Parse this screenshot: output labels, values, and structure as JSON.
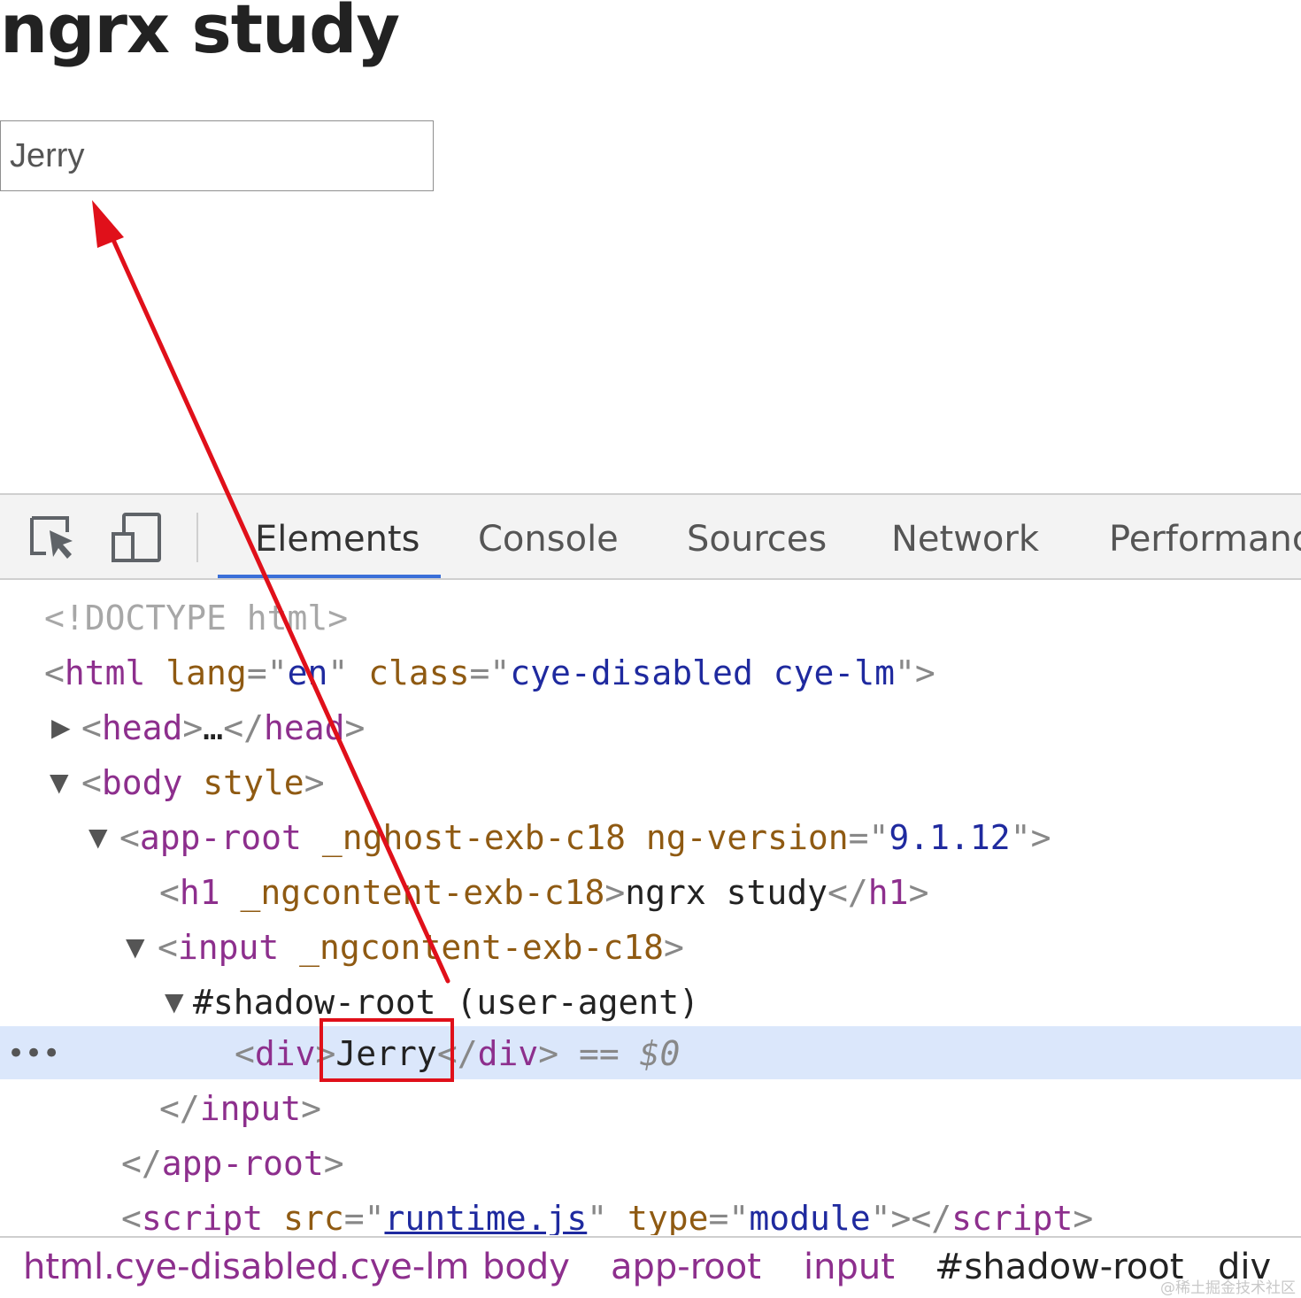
{
  "page": {
    "heading": "ngrx study",
    "input_value": "Jerry"
  },
  "devtools": {
    "icons": [
      "inspect-element-icon",
      "device-toolbar-icon"
    ],
    "tabs": [
      {
        "label": "Elements",
        "active": true
      },
      {
        "label": "Console",
        "active": false
      },
      {
        "label": "Sources",
        "active": false
      },
      {
        "label": "Network",
        "active": false
      },
      {
        "label": "Performanc",
        "active": false
      }
    ],
    "tree": {
      "doctype": "<!DOCTYPE html>",
      "html_open": {
        "tag": "html",
        "attr1": "lang",
        "val1": "en",
        "attr2": "class",
        "val2": "cye-disabled cye-lm"
      },
      "head": {
        "tag": "head",
        "ellipsis": "…"
      },
      "body": {
        "tag": "body",
        "attr": "style"
      },
      "app_root": {
        "tag": "app-root",
        "attr1": "_nghost-exb-c18",
        "attr2": "ng-version",
        "val2": "9.1.12"
      },
      "h1": {
        "tag": "h1",
        "attr": "_ngcontent-exb-c18",
        "text": "ngrx study"
      },
      "input": {
        "tag": "input",
        "attr": "_ngcontent-exb-c18"
      },
      "shadow_root": {
        "label": "#shadow-root",
        "mode": "(user-agent)"
      },
      "div": {
        "tag": "div",
        "text": "Jerry",
        "marker": "== $0"
      },
      "input_close": "input",
      "app_root_close": "app-root",
      "script": {
        "tag": "script",
        "attr1": "src",
        "val1": "runtime.js",
        "attr2": "type",
        "val2": "module"
      }
    },
    "breadcrumb": [
      {
        "label": "html.cye-disabled.cye-lm",
        "kind": "tag"
      },
      {
        "label": "body",
        "kind": "tag"
      },
      {
        "label": "app-root",
        "kind": "tag"
      },
      {
        "label": "input",
        "kind": "tag"
      },
      {
        "label": "#shadow-root",
        "kind": "plain"
      },
      {
        "label": "div",
        "kind": "plain"
      }
    ]
  },
  "watermark": "@稀土掘金技术社区",
  "colors": {
    "annotation": "#e0101a",
    "selected_row": "#dbe7fb",
    "active_tab_underline": "#3a6fd8",
    "tag": "#8d2f8d",
    "attribute": "#8f5a12",
    "value": "#1f2a9f"
  }
}
